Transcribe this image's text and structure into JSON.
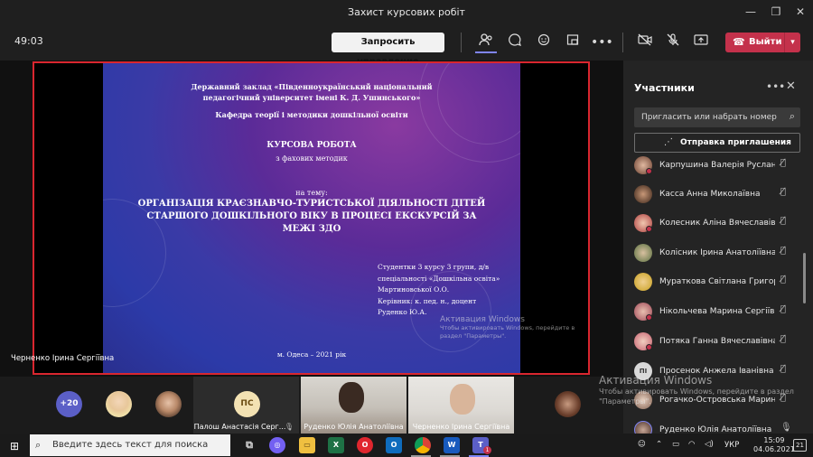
{
  "window": {
    "title": "Захист курсових робіт"
  },
  "toolbar": {
    "timer": "49:03",
    "request_control": "Запросить управление",
    "leave": "Выйти"
  },
  "slide": {
    "institution": "Державний заклад «Південноукраїнський національний педагогічний університет імені К. Д. Ушинського»",
    "department": "Кафедра теорії і методики дошкільної освіти",
    "work_type": "КУРСОВА РОБОТА",
    "subject": "з фахових методик",
    "theme_label": "на тему:",
    "topic": "ОРГАНІЗАЦІЯ КРАЄЗНАВЧО-ТУРИСТСЬКОЇ ДІЯЛЬНОСТІ ДІТЕЙ СТАРШОГО ДОШКІЛЬНОГО ВІКУ В ПРОЦЕСІ ЕКСКУРСІЙ ЗА МЕЖІ ЗДО",
    "info_lines": [
      "Студентки 3 курсу 3 групи, д/в",
      "спеціальності «Дошкільна освіта»",
      "Мартиновської О.О.",
      "Керівник: к. пед. н., доцент",
      "Руденко Ю.А."
    ],
    "city_year": "м. Одеса – 2021 рік"
  },
  "activation_small": {
    "heading": "Активация Windows",
    "text": "Чтобы активировать Windows, перейдите в раздел \"Параметры\"."
  },
  "activation_large": {
    "heading": "Активация Windows",
    "text": "Чтобы активировать Windows, перейдите в раздел \"Параметры\"."
  },
  "presenter": "Черненко Ірина Сергіївна",
  "strip": {
    "overflow_count": "+20",
    "tiles": [
      {
        "initials": "ПС",
        "name": "Палош Анастасія Серг..."
      },
      {
        "name": "Руденко Юлія Анатоліївна"
      },
      {
        "name": "Черненко Ірина Сергіївна"
      }
    ]
  },
  "panel": {
    "title": "Участники",
    "invite_placeholder": "Пригласить или набрать номер",
    "share_invite": "Отправка приглашения",
    "participants": [
      {
        "name": "Карпушина Валерія Русланів..."
      },
      {
        "name": "Касса Анна Миколаївна"
      },
      {
        "name": "Колесник Аліна Вячеславівна"
      },
      {
        "name": "Колісник Ірина Анатоліївна"
      },
      {
        "name": "Мураткова Світлана Григорі..."
      },
      {
        "name": "Нікольчева Марина Сергіївна"
      },
      {
        "name": "Потяка Ганна Вячеславівна"
      },
      {
        "name": "Просенок Анжела Іванівна",
        "initials": "ПІ"
      },
      {
        "name": "Рогачко-Островська Марин..."
      },
      {
        "name": "Руденко Юлія Анатоліївна"
      }
    ]
  },
  "taskbar": {
    "search_placeholder": "Введите здесь текст для поиска",
    "language": "УКР",
    "time": "15:09",
    "date": "04.06.2021",
    "notification_count": "21",
    "teams_badge": "1"
  },
  "colors": {
    "leave": "#c4314b",
    "slide_border": "#d9262f",
    "accent": "#5b5fc7"
  }
}
